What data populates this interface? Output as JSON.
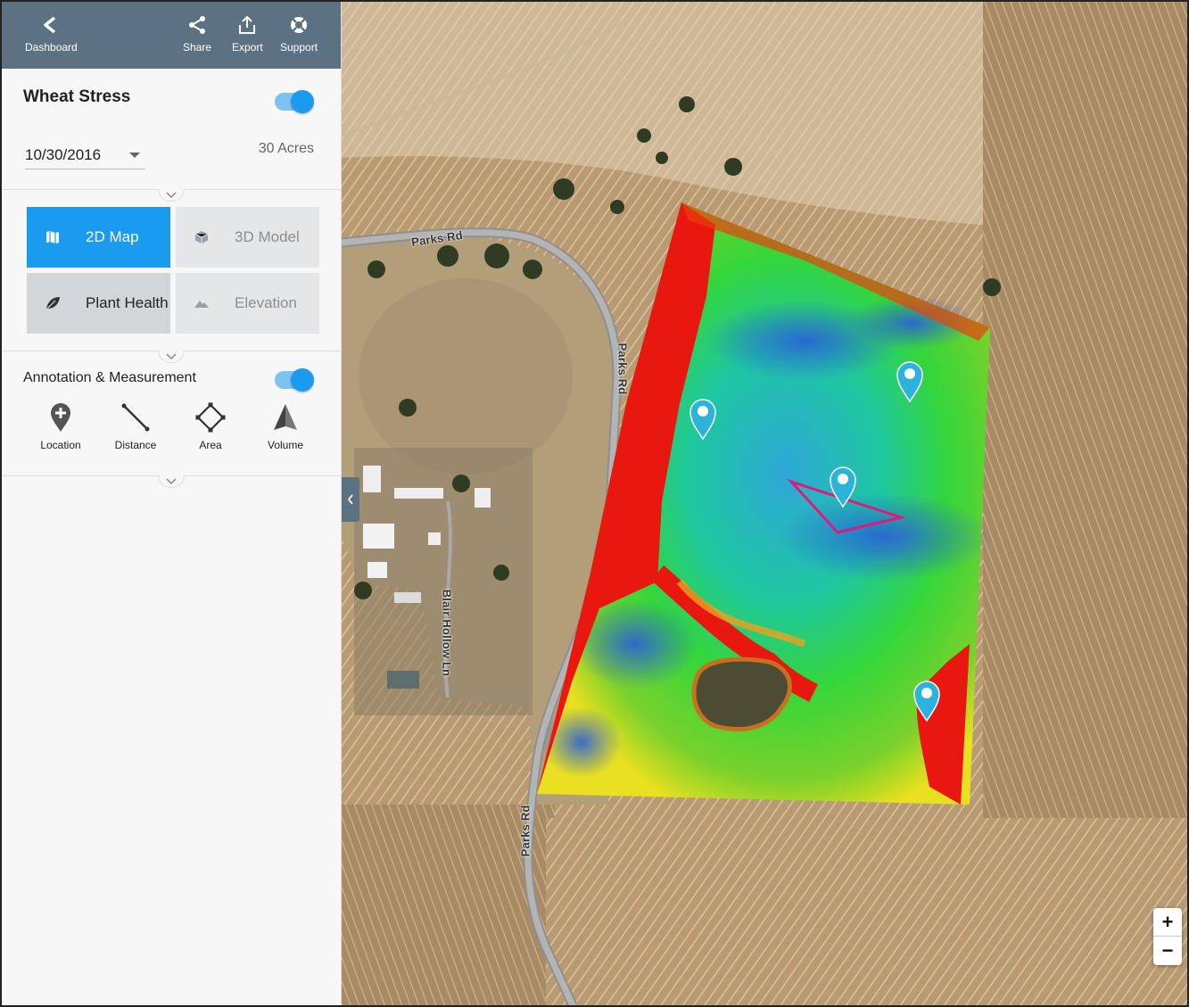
{
  "toolbar": {
    "dashboard_label": "Dashboard",
    "share_label": "Share",
    "export_label": "Export",
    "support_label": "Support",
    "icons": [
      "chevron-left-icon",
      "share-icon",
      "export-icon",
      "lifebuoy-icon"
    ]
  },
  "layer": {
    "title": "Wheat Stress",
    "enabled": true,
    "date": "10/30/2016",
    "acres": "30 Acres"
  },
  "views": {
    "map2d": "2D Map",
    "model3d": "3D Model",
    "plant_health": "Plant Health",
    "elevation": "Elevation",
    "active": "2D Map"
  },
  "annotation": {
    "title": "Annotation & Measurement",
    "enabled": true,
    "tools": {
      "location": "Location",
      "distance": "Distance",
      "area": "Area",
      "volume": "Volume"
    }
  },
  "map": {
    "road_labels": {
      "parks_rd_north": "Parks Rd",
      "parks_rd_east": "Parks Rd",
      "blair_hollow": "Blair Hollow Ln",
      "parks_rd_south": "Parks Rd"
    },
    "zoom_in": "+",
    "zoom_out": "−"
  },
  "colors": {
    "accent": "#1a9bf0",
    "topbar": "#5c7282",
    "annotation_polygon": "#e0197a",
    "pin": "#2bb3d9"
  }
}
